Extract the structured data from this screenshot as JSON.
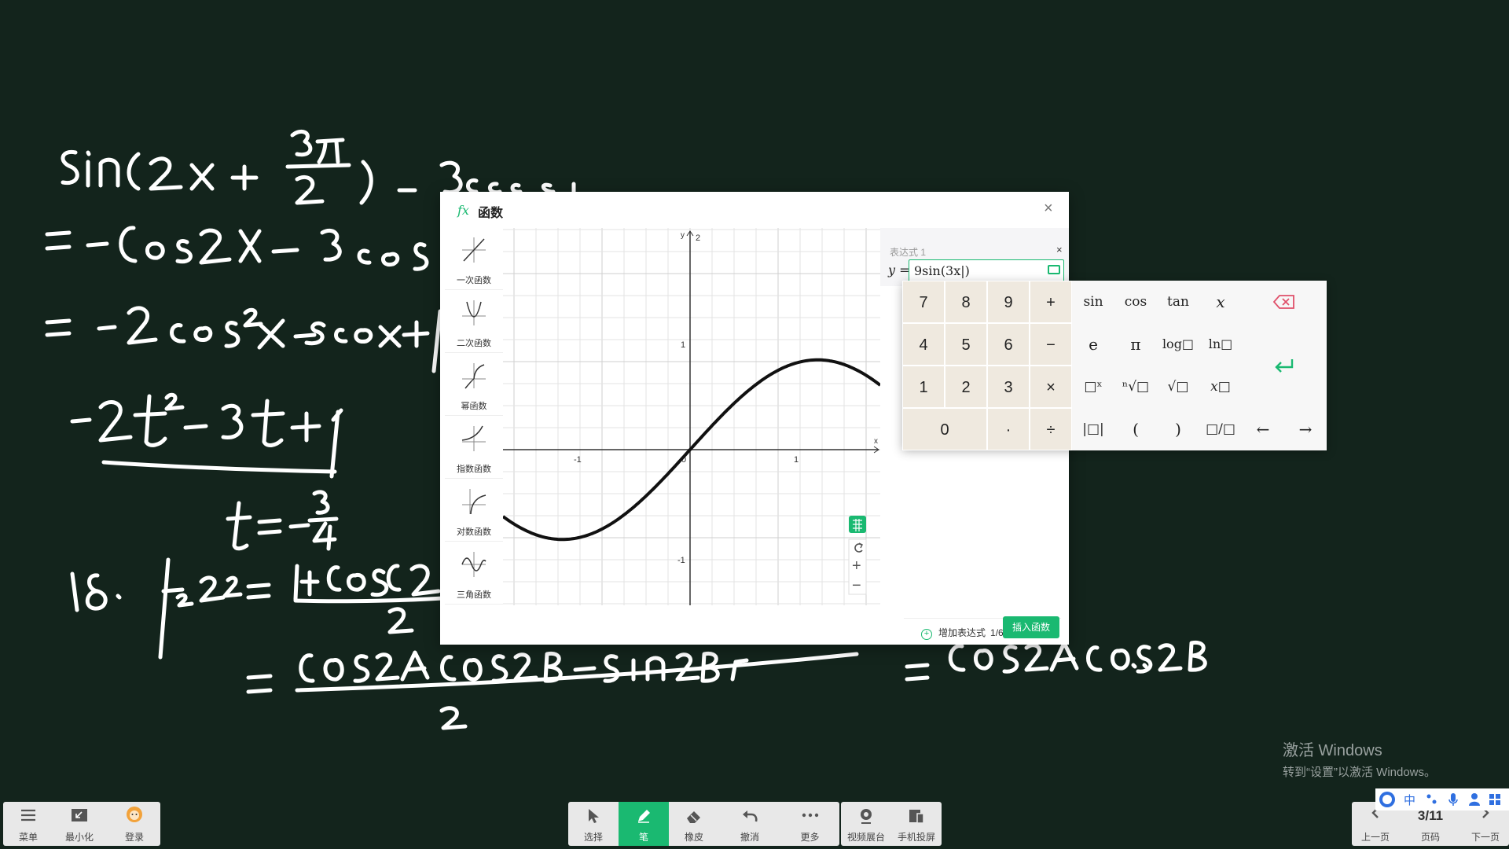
{
  "dialog": {
    "title": "函数",
    "fx_glyph": "fx",
    "close_glyph": "×",
    "types": [
      "一次函数",
      "二次函数",
      "幂函数",
      "指数函数",
      "对数函数",
      "三角函数"
    ],
    "expression": {
      "label": "表达式 1",
      "remove_glyph": "×",
      "prefix": "y =",
      "value": "9sin(3x|)"
    },
    "add_expression": "增加表达式",
    "expr_count": "1/6",
    "insert_button": "插入函数"
  },
  "graph": {
    "x_axis_label": "x",
    "y_axis_label": "y",
    "ticks": {
      "x_neg1": "-1",
      "x_pos1": "1",
      "y_pos1": "1",
      "y_neg1": "-1",
      "y_2": "2",
      "origin": "0"
    },
    "zoom_in": "+",
    "zoom_out": "−",
    "colors": {
      "grid": "#e3e3e3",
      "axis": "#333333",
      "curve": "#111111",
      "accent": "#1ab971"
    }
  },
  "keypad": {
    "digits": [
      "7",
      "8",
      "9",
      "4",
      "5",
      "6",
      "1",
      "2",
      "3",
      "0"
    ],
    "ops": {
      "plus": "+",
      "minus": "−",
      "times": "×",
      "dot": "·",
      "divide": "÷"
    },
    "functions": {
      "sin": "sin",
      "cos": "cos",
      "tan": "tan",
      "x": "x",
      "e": "e",
      "pi": "π",
      "log": "log□",
      "ln": "ln□",
      "power": "□ˣ",
      "nroot": "ⁿ√□",
      "sqrt": "√□",
      "xsup": "x□",
      "abs": "|□|",
      "lparen": "(",
      "rparen": ")",
      "fraction": "□/□",
      "left": "←",
      "right": "→"
    },
    "enter": "↵"
  },
  "toolbar_left": [
    "菜单",
    "最小化",
    "登录"
  ],
  "toolbar_center": [
    "选择",
    "笔",
    "橡皮",
    "撤消",
    "更多"
  ],
  "toolbar_right": [
    "视频展台",
    "手机投屏"
  ],
  "pager": {
    "prev": "上一页",
    "page": "3/11",
    "page_label": "页码",
    "next": "下一页"
  },
  "watermark": {
    "line1": "激活 Windows",
    "line2": "转到“设置”以激活 Windows。"
  },
  "ime": {
    "lang": "中"
  }
}
